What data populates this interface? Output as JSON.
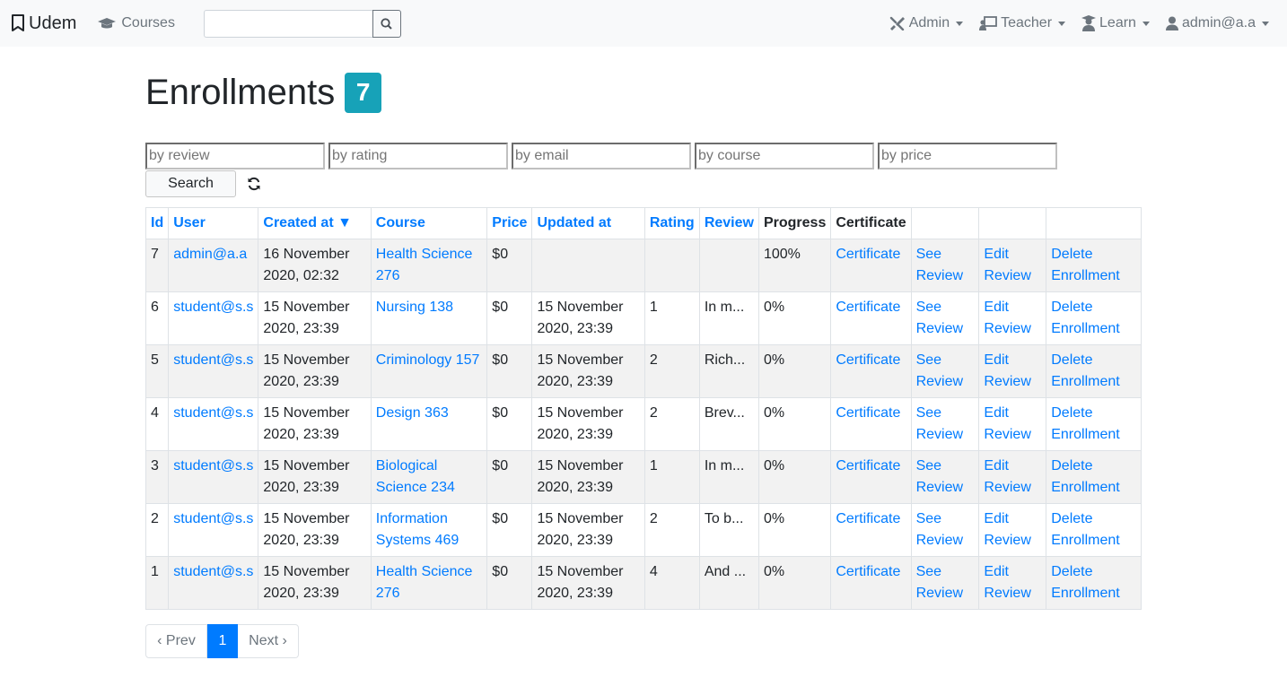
{
  "navbar": {
    "brand": "Udem",
    "courses_link": "Courses",
    "search_value": "",
    "menus": [
      {
        "label": "Admin",
        "icon": "tools-icon"
      },
      {
        "label": "Teacher",
        "icon": "chalkboard-teacher-icon"
      },
      {
        "label": "Learn",
        "icon": "user-graduate-icon"
      },
      {
        "label": "admin@a.a",
        "icon": "user-icon"
      }
    ]
  },
  "page": {
    "title": "Enrollments",
    "count": "7"
  },
  "filters": {
    "review_placeholder": "by review",
    "rating_placeholder": "by rating",
    "email_placeholder": "by email",
    "course_placeholder": "by course",
    "price_placeholder": "by price",
    "search_label": "Search"
  },
  "table": {
    "headers": [
      "Id",
      "User",
      "Created at ▼",
      "Course",
      "Price",
      "Updated at",
      "Rating",
      "Review",
      "Progress",
      "Certificate",
      "",
      "",
      ""
    ],
    "action_labels": {
      "certificate": "Certificate",
      "see": "See Review",
      "edit": "Edit Review",
      "delete": "Delete Enrollment"
    },
    "rows": [
      {
        "id": "7",
        "user": "admin@a.a",
        "created": "16 November 2020, 02:32",
        "course": "Health Science 276",
        "price": "$0",
        "updated": "",
        "rating": "",
        "review": "",
        "progress": "100%"
      },
      {
        "id": "6",
        "user": "student@s.s",
        "created": "15 November 2020, 23:39",
        "course": "Nursing 138",
        "price": "$0",
        "updated": "15 November 2020, 23:39",
        "rating": "1",
        "review": "In m...",
        "progress": "0%"
      },
      {
        "id": "5",
        "user": "student@s.s",
        "created": "15 November 2020, 23:39",
        "course": "Criminology 157",
        "price": "$0",
        "updated": "15 November 2020, 23:39",
        "rating": "2",
        "review": "Rich...",
        "progress": "0%"
      },
      {
        "id": "4",
        "user": "student@s.s",
        "created": "15 November 2020, 23:39",
        "course": "Design 363",
        "price": "$0",
        "updated": "15 November 2020, 23:39",
        "rating": "2",
        "review": "Brev...",
        "progress": "0%"
      },
      {
        "id": "3",
        "user": "student@s.s",
        "created": "15 November 2020, 23:39",
        "course": "Biological Science 234",
        "price": "$0",
        "updated": "15 November 2020, 23:39",
        "rating": "1",
        "review": "In m...",
        "progress": "0%"
      },
      {
        "id": "2",
        "user": "student@s.s",
        "created": "15 November 2020, 23:39",
        "course": "Information Systems 469",
        "price": "$0",
        "updated": "15 November 2020, 23:39",
        "rating": "2",
        "review": "To b...",
        "progress": "0%"
      },
      {
        "id": "1",
        "user": "student@s.s",
        "created": "15 November 2020, 23:39",
        "course": "Health Science 276",
        "price": "$0",
        "updated": "15 November 2020, 23:39",
        "rating": "4",
        "review": "And ...",
        "progress": "0%"
      }
    ]
  },
  "pagination": {
    "prev": "‹ Prev",
    "current": "1",
    "next": "Next ›"
  },
  "colors": {
    "link": "#007bff",
    "badge": "#17a2b8",
    "navbar_bg": "#f8f9fa"
  }
}
